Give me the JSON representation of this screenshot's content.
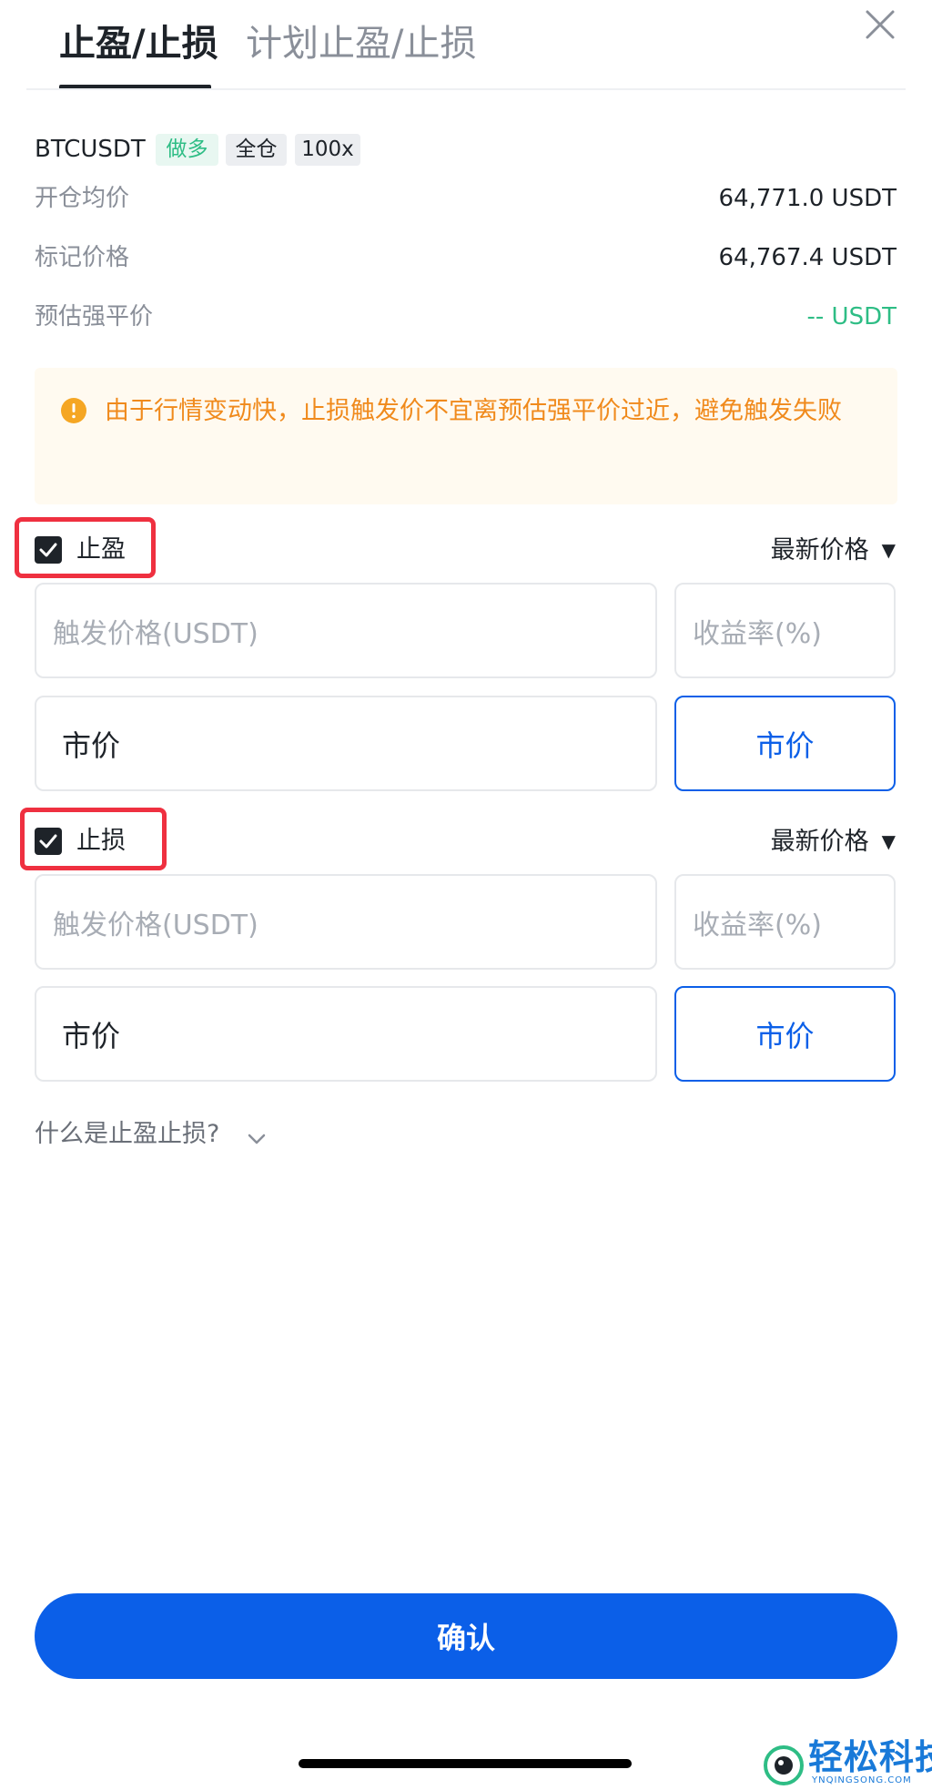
{
  "tabs": [
    {
      "label": "止盈/止损",
      "active": true
    },
    {
      "label": "计划止盈/止损",
      "active": false
    }
  ],
  "symbol": {
    "name": "BTCUSDT",
    "direction": "做多",
    "margin_mode": "全仓",
    "leverage": "100x"
  },
  "info": [
    {
      "label": "开仓均价",
      "value": "64,771.0 USDT"
    },
    {
      "label": "标记价格",
      "value": "64,767.4 USDT"
    },
    {
      "label": "预估强平价",
      "value": "-- USDT"
    }
  ],
  "warning": {
    "text": "由于行情变动快，止损触发价不宜离预估强平价过近，避免触发失败"
  },
  "take_profit": {
    "label": "止盈",
    "checked": true,
    "price_type": "最新价格",
    "trigger_placeholder": "触发价格(USDT)",
    "rate_placeholder": "收益率(%)",
    "order_value": "市价",
    "order_button": "市价"
  },
  "stop_loss": {
    "label": "止损",
    "checked": true,
    "price_type": "最新价格",
    "trigger_placeholder": "触发价格(USDT)",
    "rate_placeholder": "收益率(%)",
    "order_value": "市价",
    "order_button": "市价"
  },
  "faq": {
    "label": "什么是止盈止损?"
  },
  "confirm": {
    "label": "确认"
  },
  "watermark": {
    "title": "轻松科技",
    "subtitle": "YNQINGSONG.COM"
  },
  "colors": {
    "accent": "#0b5fe8",
    "long": "#2ebd85",
    "warning": "#f08a1c",
    "highlight": "#ef3040"
  }
}
